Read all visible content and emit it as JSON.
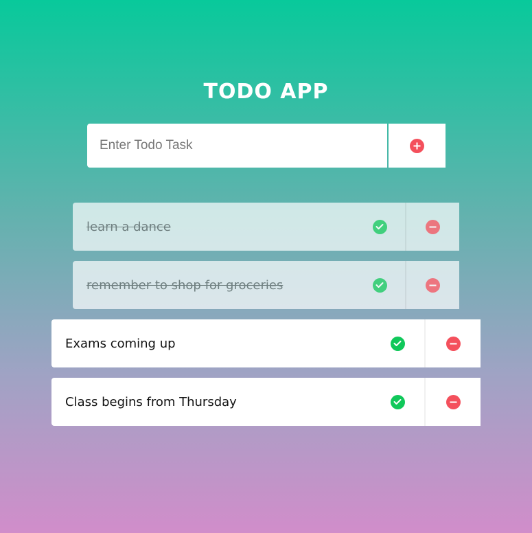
{
  "app": {
    "title": "TODO APP"
  },
  "input": {
    "placeholder": "Enter Todo Task",
    "value": "",
    "add_icon": "plus-circle-icon"
  },
  "todos": [
    {
      "text": "learn a dance",
      "completed": true
    },
    {
      "text": "remember to shop for groceries",
      "completed": true
    },
    {
      "text": "Exams coming up",
      "completed": false
    },
    {
      "text": "Class begins from Thursday",
      "completed": false
    }
  ],
  "icons": {
    "check": "check-circle-icon",
    "remove": "minus-circle-icon"
  },
  "colors": {
    "check_green": "#10c85a",
    "remove_red": "#f4505c",
    "add_red": "#f4505c",
    "gradient_top": "#08c99b",
    "gradient_bottom": "#d18dca"
  }
}
